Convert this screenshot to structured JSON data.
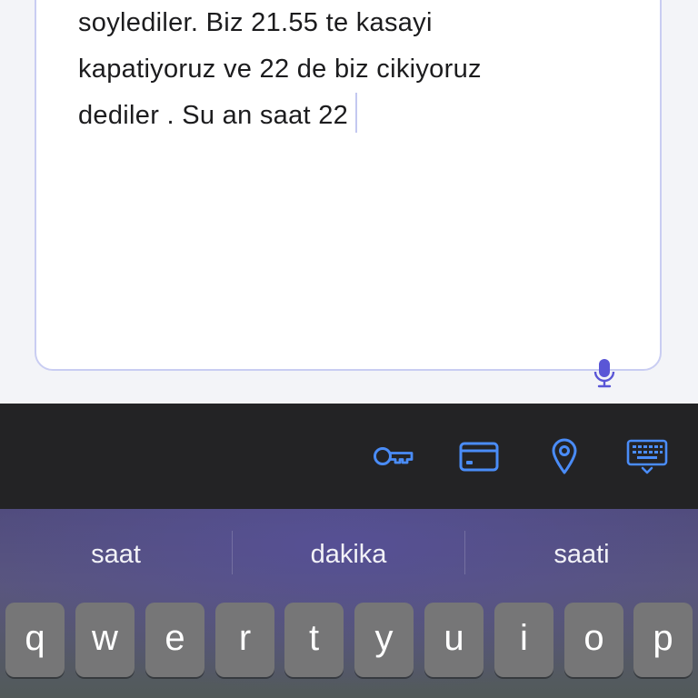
{
  "editor": {
    "lines": [
      "soylediler. Biz 21.55 te kasayi",
      "kapatiyoruz ve 22 de biz cikiyoruz",
      "dediler . Su an saat 22"
    ],
    "mic_icon": "microphone-icon"
  },
  "autofill_toolbar": {
    "icons": [
      "key-icon",
      "credit-card-icon",
      "location-pin-icon",
      "keyboard-icon"
    ],
    "accent_color": "#4a8cf7"
  },
  "keyboard": {
    "suggestions": [
      "saat",
      "dakika",
      "saati"
    ],
    "keys": [
      "q",
      "w",
      "e",
      "r",
      "t",
      "y",
      "u",
      "i",
      "o",
      "p"
    ]
  },
  "colors": {
    "accent": "#5a56d6",
    "text": "#1c1c1e",
    "key_bg": "#767677"
  }
}
